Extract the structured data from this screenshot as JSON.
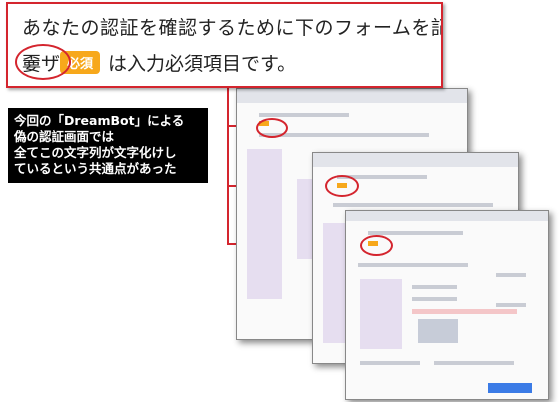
{
  "callout": {
    "line1": "あなたの認証を確認するために下のフォームを記入",
    "garbled": "嫑ザ",
    "badge": "必須",
    "line2_rest": "は入力必須項目です。"
  },
  "note": {
    "lines": [
      "今回の「DreamBot」による",
      "偽の認証画面では",
      "全てこの文字列が文字化けし",
      "ているという共通点があった"
    ]
  },
  "colors": {
    "highlight": "#d4252e",
    "badge": "#f7a81b",
    "note_bg": "#000000"
  },
  "screenshots": {
    "count": 3
  }
}
